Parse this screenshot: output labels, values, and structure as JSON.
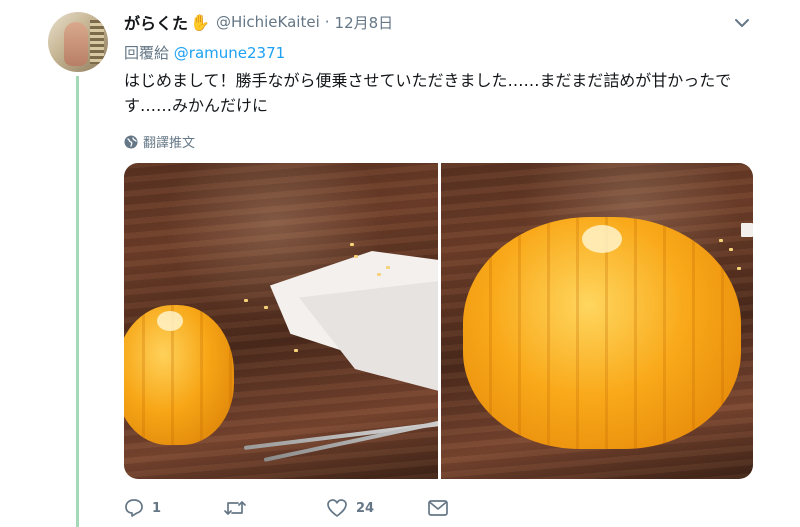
{
  "tweet": {
    "display_name": "がらくた",
    "name_emoji": "✋",
    "handle": "@HichieKaitei",
    "separator": "·",
    "date": "12月8日",
    "reply_prefix": "回覆給",
    "reply_mention": "@ramune2371",
    "text": "はじめまして！勝手ながら便乗させていただきました……まだまだ詰めが甘かったです……みかんだけに",
    "translate_label": "翻譯推文"
  },
  "actions": {
    "reply_count": "1",
    "retweet_count": "",
    "like_count": "24"
  },
  "icons": {
    "more": "chevron-down-icon",
    "translate": "globe-icon",
    "reply": "reply-icon",
    "retweet": "retweet-icon",
    "like": "heart-icon",
    "message": "envelope-icon"
  },
  "colors": {
    "thread_line": "#a4d9b8",
    "mention": "#1da1f2",
    "secondary_text": "#657786"
  }
}
